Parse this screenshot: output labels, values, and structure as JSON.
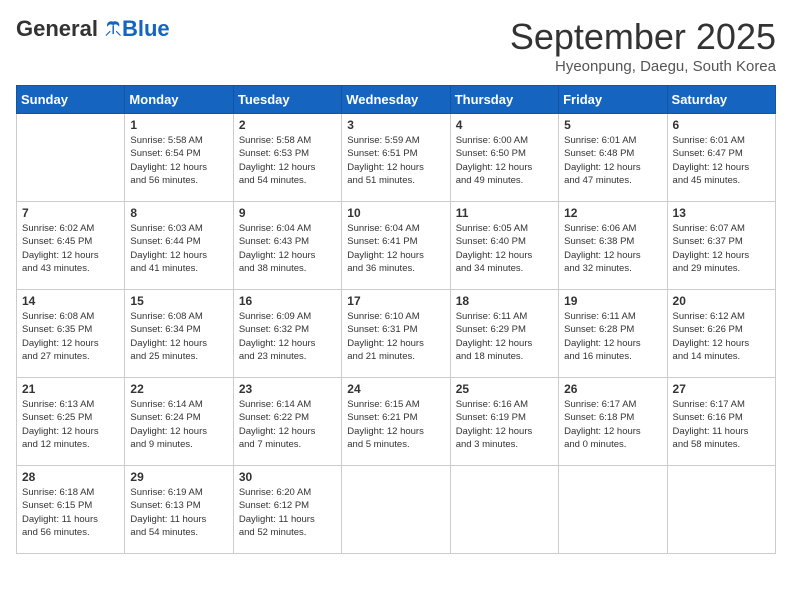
{
  "logo": {
    "general": "General",
    "blue": "Blue"
  },
  "header": {
    "month": "September 2025",
    "location": "Hyeonpung, Daegu, South Korea"
  },
  "weekdays": [
    "Sunday",
    "Monday",
    "Tuesday",
    "Wednesday",
    "Thursday",
    "Friday",
    "Saturday"
  ],
  "weeks": [
    [
      {
        "day": "",
        "info": ""
      },
      {
        "day": "1",
        "info": "Sunrise: 5:58 AM\nSunset: 6:54 PM\nDaylight: 12 hours\nand 56 minutes."
      },
      {
        "day": "2",
        "info": "Sunrise: 5:58 AM\nSunset: 6:53 PM\nDaylight: 12 hours\nand 54 minutes."
      },
      {
        "day": "3",
        "info": "Sunrise: 5:59 AM\nSunset: 6:51 PM\nDaylight: 12 hours\nand 51 minutes."
      },
      {
        "day": "4",
        "info": "Sunrise: 6:00 AM\nSunset: 6:50 PM\nDaylight: 12 hours\nand 49 minutes."
      },
      {
        "day": "5",
        "info": "Sunrise: 6:01 AM\nSunset: 6:48 PM\nDaylight: 12 hours\nand 47 minutes."
      },
      {
        "day": "6",
        "info": "Sunrise: 6:01 AM\nSunset: 6:47 PM\nDaylight: 12 hours\nand 45 minutes."
      }
    ],
    [
      {
        "day": "7",
        "info": "Sunrise: 6:02 AM\nSunset: 6:45 PM\nDaylight: 12 hours\nand 43 minutes."
      },
      {
        "day": "8",
        "info": "Sunrise: 6:03 AM\nSunset: 6:44 PM\nDaylight: 12 hours\nand 41 minutes."
      },
      {
        "day": "9",
        "info": "Sunrise: 6:04 AM\nSunset: 6:43 PM\nDaylight: 12 hours\nand 38 minutes."
      },
      {
        "day": "10",
        "info": "Sunrise: 6:04 AM\nSunset: 6:41 PM\nDaylight: 12 hours\nand 36 minutes."
      },
      {
        "day": "11",
        "info": "Sunrise: 6:05 AM\nSunset: 6:40 PM\nDaylight: 12 hours\nand 34 minutes."
      },
      {
        "day": "12",
        "info": "Sunrise: 6:06 AM\nSunset: 6:38 PM\nDaylight: 12 hours\nand 32 minutes."
      },
      {
        "day": "13",
        "info": "Sunrise: 6:07 AM\nSunset: 6:37 PM\nDaylight: 12 hours\nand 29 minutes."
      }
    ],
    [
      {
        "day": "14",
        "info": "Sunrise: 6:08 AM\nSunset: 6:35 PM\nDaylight: 12 hours\nand 27 minutes."
      },
      {
        "day": "15",
        "info": "Sunrise: 6:08 AM\nSunset: 6:34 PM\nDaylight: 12 hours\nand 25 minutes."
      },
      {
        "day": "16",
        "info": "Sunrise: 6:09 AM\nSunset: 6:32 PM\nDaylight: 12 hours\nand 23 minutes."
      },
      {
        "day": "17",
        "info": "Sunrise: 6:10 AM\nSunset: 6:31 PM\nDaylight: 12 hours\nand 21 minutes."
      },
      {
        "day": "18",
        "info": "Sunrise: 6:11 AM\nSunset: 6:29 PM\nDaylight: 12 hours\nand 18 minutes."
      },
      {
        "day": "19",
        "info": "Sunrise: 6:11 AM\nSunset: 6:28 PM\nDaylight: 12 hours\nand 16 minutes."
      },
      {
        "day": "20",
        "info": "Sunrise: 6:12 AM\nSunset: 6:26 PM\nDaylight: 12 hours\nand 14 minutes."
      }
    ],
    [
      {
        "day": "21",
        "info": "Sunrise: 6:13 AM\nSunset: 6:25 PM\nDaylight: 12 hours\nand 12 minutes."
      },
      {
        "day": "22",
        "info": "Sunrise: 6:14 AM\nSunset: 6:24 PM\nDaylight: 12 hours\nand 9 minutes."
      },
      {
        "day": "23",
        "info": "Sunrise: 6:14 AM\nSunset: 6:22 PM\nDaylight: 12 hours\nand 7 minutes."
      },
      {
        "day": "24",
        "info": "Sunrise: 6:15 AM\nSunset: 6:21 PM\nDaylight: 12 hours\nand 5 minutes."
      },
      {
        "day": "25",
        "info": "Sunrise: 6:16 AM\nSunset: 6:19 PM\nDaylight: 12 hours\nand 3 minutes."
      },
      {
        "day": "26",
        "info": "Sunrise: 6:17 AM\nSunset: 6:18 PM\nDaylight: 12 hours\nand 0 minutes."
      },
      {
        "day": "27",
        "info": "Sunrise: 6:17 AM\nSunset: 6:16 PM\nDaylight: 11 hours\nand 58 minutes."
      }
    ],
    [
      {
        "day": "28",
        "info": "Sunrise: 6:18 AM\nSunset: 6:15 PM\nDaylight: 11 hours\nand 56 minutes."
      },
      {
        "day": "29",
        "info": "Sunrise: 6:19 AM\nSunset: 6:13 PM\nDaylight: 11 hours\nand 54 minutes."
      },
      {
        "day": "30",
        "info": "Sunrise: 6:20 AM\nSunset: 6:12 PM\nDaylight: 11 hours\nand 52 minutes."
      },
      {
        "day": "",
        "info": ""
      },
      {
        "day": "",
        "info": ""
      },
      {
        "day": "",
        "info": ""
      },
      {
        "day": "",
        "info": ""
      }
    ]
  ]
}
